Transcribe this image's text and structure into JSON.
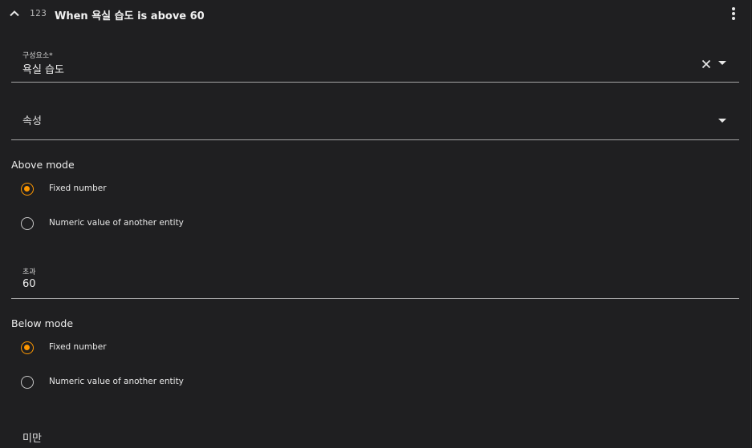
{
  "header": {
    "type_icon_text": "123",
    "title": "When 욕실 습도 is above 60"
  },
  "entity_field": {
    "label": "구성요소*",
    "value": "욕실 습도"
  },
  "attribute_field": {
    "placeholder": "속성"
  },
  "above_mode": {
    "title": "Above mode",
    "options": [
      {
        "label": "Fixed number",
        "selected": true
      },
      {
        "label": "Numeric value of another entity",
        "selected": false
      }
    ]
  },
  "above_field": {
    "label": "초과",
    "value": "60"
  },
  "below_mode": {
    "title": "Below mode",
    "options": [
      {
        "label": "Fixed number",
        "selected": true
      },
      {
        "label": "Numeric value of another entity",
        "selected": false
      }
    ]
  },
  "below_field": {
    "placeholder": "미만"
  },
  "colors": {
    "accent": "#ff9800",
    "background": "#1f1f21"
  }
}
